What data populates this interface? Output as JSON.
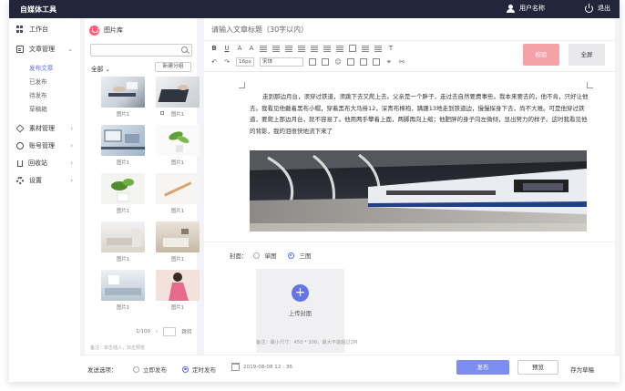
{
  "app": {
    "title": "自媒体工具",
    "username": "用户名称",
    "logout": "退出"
  },
  "sidebar": {
    "items": [
      {
        "label": "工作台",
        "icon": "dashboard-icon"
      },
      {
        "label": "文章管理",
        "icon": "article-icon",
        "expanded": true
      },
      {
        "label": "素材管理",
        "icon": "material-icon"
      },
      {
        "label": "账号管理",
        "icon": "account-icon"
      },
      {
        "label": "回收站",
        "icon": "trash-icon"
      },
      {
        "label": "设置",
        "icon": "settings-icon"
      }
    ],
    "subitems": [
      {
        "label": "发布文章",
        "active": true
      },
      {
        "label": "已发布"
      },
      {
        "label": "待发布"
      },
      {
        "label": "草稿箱"
      }
    ]
  },
  "library": {
    "title": "图片库",
    "search_placeholder": "",
    "filter": "全部",
    "new_group": "新建分组",
    "thumb_label": "图片1",
    "pager": "1/100",
    "pager_go": "跳转",
    "note": "备注：单击插入，双击预览"
  },
  "editor": {
    "title_placeholder": "请输入文章标题（30字以内）",
    "font_size": "16px",
    "font_family": "宋体",
    "check_button": "校验",
    "fullscreen_button": "全屏",
    "article": "走到那边月台，须穿过铁道，须跳下去又爬上去。父亲是一个胖子，走过去自然要费事些。我本来要去的，他不肯，只好让他去。我看见他戴着黑布小帽，穿着黑布大马褂12，深青布棉袍，蹒跚13地走到铁道边，慢慢探身下去，尚不大难。可是他穿过铁道，要爬上那边月台，就不容易了。他用两手攀着上面，两脚再向上缩；他肥胖的身子向左微倾，显出努力的样子。这时我看见他的背影，我的泪很快地流下来了",
    "cover_label": "封面：",
    "cover_single": "单图",
    "cover_triple": "三图",
    "upload_label": "上传封面",
    "cover_note": "备注：最小尺寸：450 * 300，最大不能超过2M"
  },
  "bottom": {
    "label": "发送选项：",
    "now": "立即发布",
    "scheduled": "定时发布",
    "datetime": "2019-08-08  12 : 36",
    "publish": "发布",
    "preview": "预览",
    "draft": "存为草稿"
  },
  "colors": {
    "accent": "#5b6ee8",
    "topbar": "#23263a",
    "check_button": "#f3a2a7"
  }
}
